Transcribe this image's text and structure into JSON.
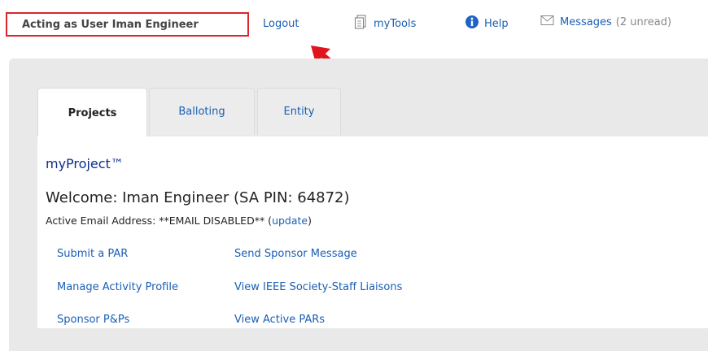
{
  "topbar": {
    "acting_label": "Acting as User Iman Engineer",
    "logout": "Logout",
    "mytools": "myTools",
    "help": "Help",
    "messages": "Messages",
    "messages_unread": "(2 unread)"
  },
  "tabs": [
    {
      "label": "Projects",
      "active": true
    },
    {
      "label": "Balloting",
      "active": false
    },
    {
      "label": "Entity",
      "active": false
    }
  ],
  "content": {
    "brand": "myProject™",
    "welcome": "Welcome: Iman Engineer (SA PIN: 64872)",
    "email_prefix": "Active Email Address: **EMAIL DISABLED** (",
    "email_update": "update",
    "email_suffix": ")",
    "links": {
      "submit_par": "Submit a PAR",
      "send_sponsor_message": "Send Sponsor Message",
      "manage_activity_profile": "Manage Activity Profile",
      "view_liaisons": "View IEEE Society-Staff Liaisons",
      "sponsor_pps": "Sponsor P&Ps",
      "view_active_pars": "View Active PARs"
    }
  },
  "colors": {
    "link": "#1a5fb4",
    "highlight_border": "#d9262c",
    "arrow": "#e0141c",
    "brand": "#0b2e8a"
  }
}
